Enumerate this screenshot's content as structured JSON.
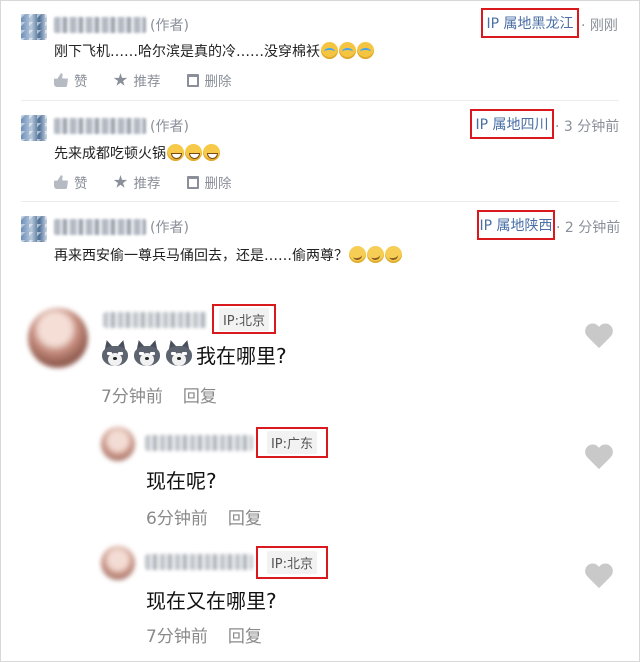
{
  "web_comments": [
    {
      "author_tag": "(作者)",
      "ip_label": "IP 属地黑龙江",
      "time": "· 刚刚",
      "text": "刚下飞机……哈尔滨是真的冷……没穿棉袄",
      "emoji": "cry-icon",
      "actions": {
        "like": "赞",
        "recommend": "推荐",
        "delete": "删除"
      }
    },
    {
      "author_tag": "(作者)",
      "ip_label": "IP 属地四川",
      "time": "· 3 分钟前",
      "text": "先来成都吃顿火锅",
      "emoji": "grin-icon",
      "actions": {
        "like": "赞",
        "recommend": "推荐",
        "delete": "删除"
      }
    },
    {
      "author_tag": "(作者)",
      "ip_label": "IP 属地陕西",
      "time": "· 2 分钟前",
      "text": "再来西安偷一尊兵马俑回去，还是……偷两尊？",
      "emoji": "thinking-icon"
    }
  ],
  "mobile_comments": [
    {
      "ip_label": "IP:北京",
      "text": "我在哪里?",
      "time": "7分钟前",
      "reply": "回复",
      "emoji": "husky-icon"
    },
    {
      "ip_label": "IP:广东",
      "text": "现在呢?",
      "time": "6分钟前",
      "reply": "回复"
    },
    {
      "ip_label": "IP:北京",
      "text": "现在又在哪里?",
      "time": "7分钟前",
      "reply": "回复"
    }
  ],
  "colors": {
    "highlight_border": "#d9191e",
    "ip_text": "#4a6fa5",
    "muted": "#8a8f99",
    "heart": "#c9c9c9"
  }
}
